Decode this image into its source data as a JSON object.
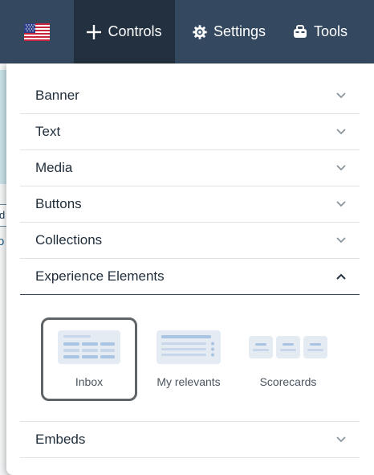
{
  "topbar": {
    "flag_icon": "us-flag-icon",
    "controls": {
      "label": "Controls",
      "icon": "plus-icon"
    },
    "settings": {
      "label": "Settings",
      "icon": "gear-icon"
    },
    "tools": {
      "label": "Tools",
      "icon": "toolbox-icon"
    }
  },
  "background": {
    "fragment_box": "d",
    "fragment_text": "o"
  },
  "menu": {
    "items": [
      {
        "label": "Banner"
      },
      {
        "label": "Text"
      },
      {
        "label": "Media"
      },
      {
        "label": "Buttons"
      },
      {
        "label": "Collections"
      },
      {
        "label": "Experience Elements"
      },
      {
        "label": "Embeds"
      }
    ],
    "elements": [
      {
        "label": "Inbox",
        "selected": true
      },
      {
        "label": "My relevants",
        "selected": false
      },
      {
        "label": "Scorecards",
        "selected": false
      }
    ]
  },
  "colors": {
    "topbar": "#34495f",
    "topbar_active": "#22303f",
    "thumb_fill": "#e4ebf3",
    "thumb_bar": "#a9c4e2"
  }
}
